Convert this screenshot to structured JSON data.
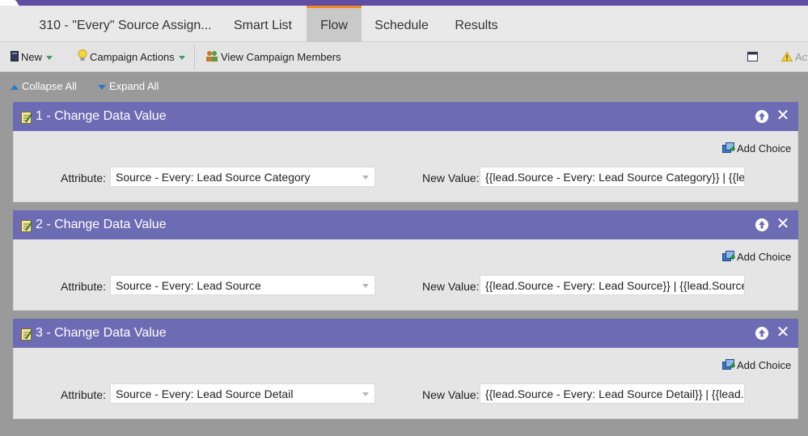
{
  "tabs": {
    "program": "310 - \"Every\" Source Assign...",
    "smart_list": "Smart List",
    "flow": "Flow",
    "schedule": "Schedule",
    "results": "Results"
  },
  "toolbar": {
    "new_label": "New",
    "campaign_actions_label": "Campaign Actions",
    "view_members_label": "View Campaign Members",
    "activate_label": "Act"
  },
  "subbar": {
    "collapse_label": "Collapse All",
    "expand_label": "Expand All"
  },
  "common": {
    "add_choice": "Add Choice",
    "attribute_label": "Attribute:",
    "new_value_label": "New Value:"
  },
  "steps": [
    {
      "title": "1 - Change Data Value",
      "attribute": "Source - Every: Lead Source Category",
      "new_value": "{{lead.Source - Every: Lead Source Category}} | {{leac"
    },
    {
      "title": "2 - Change Data Value",
      "attribute": "Source - Every: Lead Source",
      "new_value": "{{lead.Source - Every: Lead Source}} | {{lead.Source -"
    },
    {
      "title": "3 - Change Data Value",
      "attribute": "Source - Every: Lead Source Detail",
      "new_value": "{{lead.Source - Every: Lead Source Detail}} | {{lead.Sc"
    }
  ],
  "colors": {
    "header_purple": "#6e6bb5",
    "brand_purple": "#5e4fa2",
    "active_tab_accent": "#f28a24"
  }
}
